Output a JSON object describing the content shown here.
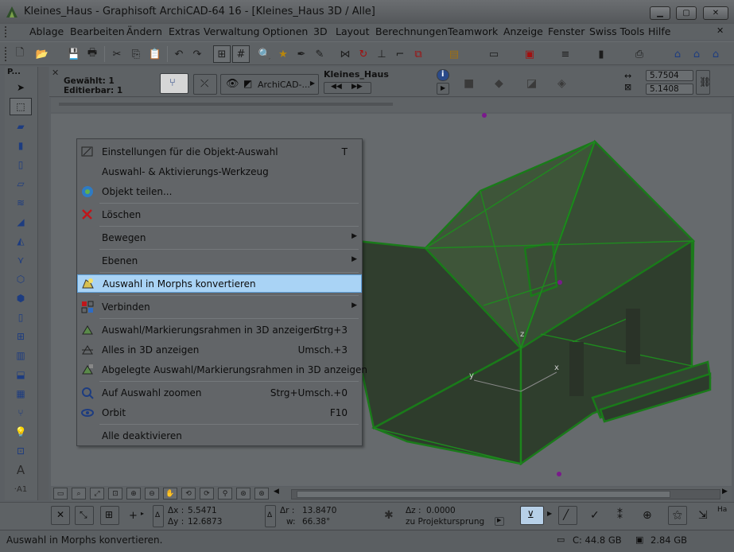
{
  "titlebar": {
    "title": "Kleines_Haus - Graphisoft ArchiCAD-64 16 - [Kleines_Haus 3D / Alle]"
  },
  "menubar": {
    "items": [
      "Ablage",
      "Bearbeiten",
      "Ändern",
      "Extras",
      "Verwaltung",
      "Optionen",
      "3D",
      "Layout",
      "Berechnungen",
      "Teamwork",
      "Anzeige",
      "Fenster",
      "Swiss Tools",
      "Hilfe"
    ]
  },
  "infobox": {
    "selected_label": "Gewählt: 1",
    "editable_label": "Editierbar: 1",
    "layer_value": "ArchiCAD-...",
    "view_name": "Kleines_Haus",
    "dim_a": "5.7504",
    "dim_b": "5.1408"
  },
  "toolbox": {
    "title": "P..."
  },
  "context_menu": {
    "items": [
      {
        "label": "Einstellungen für die Objekt-Auswahl",
        "shortcut": "T",
        "icon": "object-settings-icon"
      },
      {
        "label": "Auswahl- & Aktivierungs-Werkzeug",
        "shortcut": "",
        "icon": ""
      },
      {
        "label": "Objekt teilen...",
        "shortcut": "",
        "icon": "share-object-icon"
      },
      {
        "label": "Löschen",
        "shortcut": "",
        "icon": "delete-icon"
      },
      {
        "label": "Bewegen",
        "shortcut": "",
        "icon": "",
        "submenu": true
      },
      {
        "label": "Ebenen",
        "shortcut": "",
        "icon": "",
        "submenu": true
      },
      {
        "label": "Auswahl in Morphs konvertieren",
        "shortcut": "",
        "icon": "morph-convert-icon",
        "highlighted": true
      },
      {
        "label": "Verbinden",
        "shortcut": "",
        "icon": "connect-icon",
        "submenu": true
      },
      {
        "label": "Auswahl/Markierungsrahmen in 3D anzeigen",
        "shortcut": "Strg+3",
        "icon": "show-3d-selection-icon"
      },
      {
        "label": "Alles in 3D anzeigen",
        "shortcut": "Umsch.+3",
        "icon": "show-all-3d-icon"
      },
      {
        "label": "Abgelegte Auswahl/Markierungsrahmen in 3D anzeigen",
        "shortcut": "",
        "icon": "stored-selection-3d-icon"
      },
      {
        "label": "Auf Auswahl zoomen",
        "shortcut": "Strg+Umsch.+0",
        "icon": "zoom-selection-icon"
      },
      {
        "label": "Orbit",
        "shortcut": "F10",
        "icon": "orbit-icon"
      },
      {
        "label": "Alle deaktivieren",
        "shortcut": "",
        "icon": ""
      }
    ]
  },
  "coords": {
    "dx_label": "Δx :",
    "dx_value": "5.5471",
    "dy_label": "Δy :",
    "dy_value": "12.6873",
    "dr_label": "Δr :",
    "dr_value": "13.8470",
    "w_label": "w:",
    "w_value": "66.38°",
    "dz_label": "Δz :",
    "dz_value": "0.0000",
    "projection_label": "zu Projektursprung"
  },
  "axis_labels": {
    "z": "z",
    "y": "y",
    "x": "x"
  },
  "statusbar": {
    "message": "Auswahl in Morphs konvertieren.",
    "disk_label": "C: 44.8 GB",
    "memory_label": "2.84 GB"
  }
}
